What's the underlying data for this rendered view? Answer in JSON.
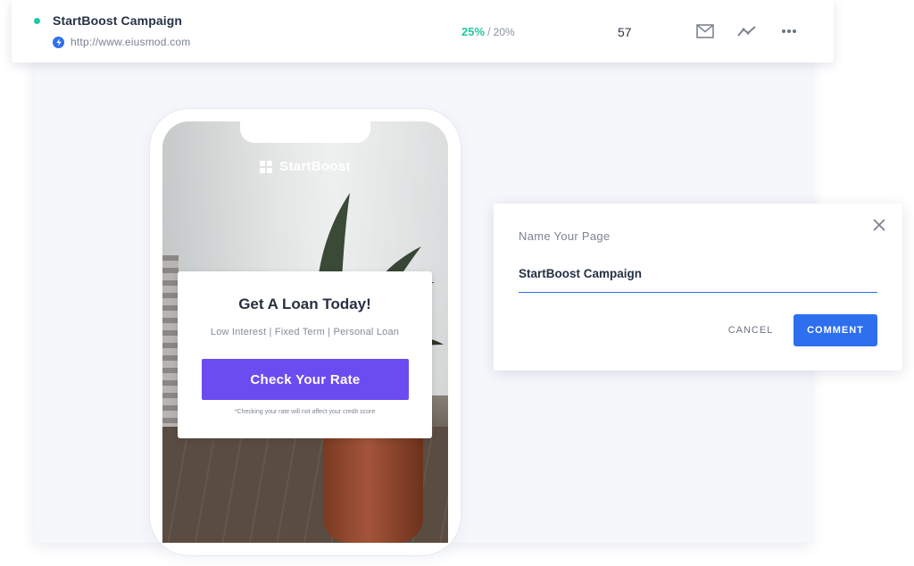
{
  "campaign": {
    "name": "StartBoost Campaign",
    "url": "http://www.eiusmod.com",
    "conversion_rate": "25%",
    "goal_rate": "20%",
    "count": "57",
    "status_color": "#1fc9a5",
    "icons": {
      "url": "bolt-icon",
      "mail": "mail-icon",
      "trend": "trend-icon",
      "more": "more-icon"
    }
  },
  "preview": {
    "brand": "StartBoost",
    "card_title": "Get A Loan Today!",
    "card_subtitle": "Low Interest | Fixed Term | Personal Loan",
    "cta_label": "Check Your Rate",
    "disclaimer": "*Checking your rate will not affect your credit score",
    "cta_color": "#6b4cf0"
  },
  "modal": {
    "label": "Name Your Page",
    "input_value": "StartBoost Campaign",
    "cancel_label": "CANCEL",
    "comment_label": "COMMENT",
    "accent": "#2d6fee"
  }
}
